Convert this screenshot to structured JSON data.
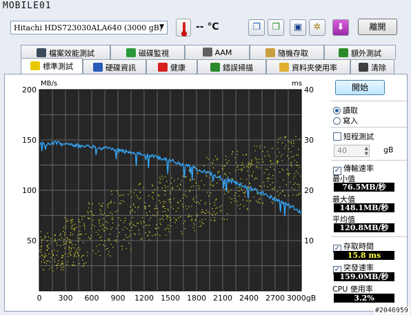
{
  "watermark": "MOBILE01",
  "toolbar": {
    "drive_label": "Hitachi HDS723030ALA640  (3000 gB)",
    "temperature": "-- ℃",
    "exit_label": "離開"
  },
  "tabs_top": [
    {
      "label": "檔案效能測試",
      "icon": "file-benchmark-icon",
      "color": "#3a4a5a"
    },
    {
      "label": "磁碟監視",
      "icon": "disk-monitor-icon",
      "color": "#2a9a3a"
    },
    {
      "label": "AAM",
      "icon": "speaker-icon",
      "color": "#606060"
    },
    {
      "label": "隨機存取",
      "icon": "random-access-icon",
      "color": "#c8a040"
    },
    {
      "label": "額外測試",
      "icon": "extra-tests-icon",
      "color": "#2a8a2a"
    }
  ],
  "tabs_bottom": [
    {
      "label": "標準測試",
      "icon": "lightbulb-icon",
      "color": "#e8c800"
    },
    {
      "label": "硬碟資訊",
      "icon": "info-icon",
      "color": "#2a5ab8"
    },
    {
      "label": "健康",
      "icon": "health-cross-icon",
      "color": "#d82020"
    },
    {
      "label": "錯誤掃描",
      "icon": "magnifier-icon",
      "color": "#2a8a2a"
    },
    {
      "label": "資料夾使用率",
      "icon": "folder-icon",
      "color": "#e0b030"
    },
    {
      "label": "清除",
      "icon": "trash-icon",
      "color": "#404040"
    }
  ],
  "controls": {
    "start_label": "開始",
    "read_label": "讀取",
    "write_label": "寫入",
    "short_test_label": "短程測試",
    "short_test_value": "40",
    "short_test_unit": "gB",
    "transfer_rate_label": "傳輸速率",
    "min_label": "最小值",
    "min_value": "76.5MB/秒",
    "max_label": "最大值",
    "max_value": "148.1MB/秒",
    "avg_label": "平均值",
    "avg_value": "120.8MB/秒",
    "access_time_label": "存取時間",
    "access_time_value": "15.8 ms",
    "burst_rate_label": "突發速率",
    "burst_rate_value": "159.0MB/秒",
    "cpu_label": "CPU 使用率",
    "cpu_value": "3.2%"
  },
  "image_tag": "#2046959",
  "colors": {
    "transfer_line": "#33aaff",
    "access_dots": "#d8d830",
    "plot_bg": "#262626",
    "grid": "#666666"
  },
  "chart_data": {
    "type": "line",
    "y_left_label": "MB/s",
    "y_right_label": "ms",
    "x_unit": "gB",
    "xlim": [
      0,
      3000
    ],
    "ylim_left": [
      0,
      200
    ],
    "ylim_right": [
      0,
      40
    ],
    "x_ticks": [
      "0",
      "300",
      "600",
      "900",
      "1200",
      "1500",
      "1800",
      "2100",
      "2400",
      "2700",
      "3000gB"
    ],
    "y_left_ticks": [
      "200",
      "150",
      "100",
      "50"
    ],
    "y_right_ticks": [
      "40",
      "30",
      "20",
      "10"
    ],
    "grid": true,
    "series": [
      {
        "name": "傳輸速率",
        "axis": "left",
        "x": [
          0,
          100,
          200,
          300,
          400,
          500,
          600,
          700,
          800,
          900,
          1000,
          1100,
          1200,
          1300,
          1400,
          1500,
          1600,
          1700,
          1800,
          1900,
          2000,
          2100,
          2200,
          2300,
          2400,
          2500,
          2600,
          2700,
          2800,
          2900,
          3000
        ],
        "y": [
          147,
          146,
          147,
          145,
          145,
          143,
          144,
          141,
          142,
          140,
          138,
          137,
          135,
          134,
          131,
          130,
          126,
          124,
          121,
          119,
          115,
          112,
          109,
          106,
          102,
          99,
          95,
          91,
          87,
          83,
          78
        ]
      },
      {
        "name": "存取時間",
        "axis": "right",
        "type": "scatter",
        "x_range": [
          0,
          3000
        ],
        "y_min_ms": [
          4,
          5,
          7,
          8,
          10,
          11,
          12,
          14,
          16,
          17,
          19
        ],
        "y_max_ms": [
          12,
          15,
          18,
          20,
          22,
          23,
          25,
          27,
          28,
          29,
          31
        ],
        "average_ms": 15.8
      }
    ]
  }
}
